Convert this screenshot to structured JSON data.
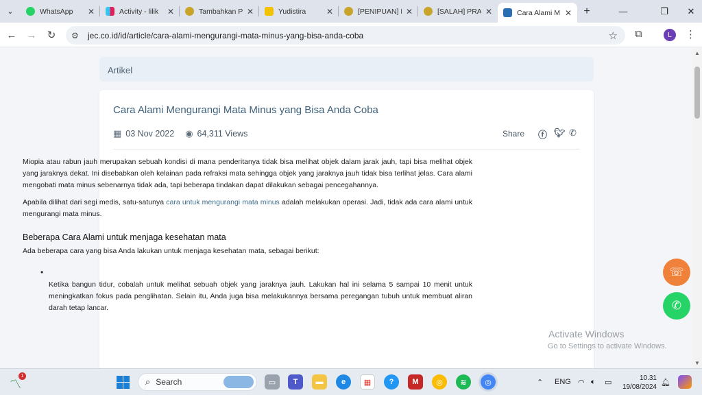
{
  "browser": {
    "tabs": [
      {
        "label": "WhatsApp",
        "icon": "whatsapp-icon",
        "color": "#25d366"
      },
      {
        "label": "Activity - lilik",
        "icon": "slack-icon",
        "color": "#e01e5a"
      },
      {
        "label": "Tambahkan P",
        "icon": "site-logo-icon",
        "color": "#c8a42a"
      },
      {
        "label": "Yudistira",
        "icon": "yudistira-icon",
        "color": "#222222"
      },
      {
        "label": "[PENIPUAN] P",
        "icon": "site-logo-icon",
        "color": "#c8a42a"
      },
      {
        "label": "[SALAH] PRAI",
        "icon": "site-logo-icon",
        "color": "#c8a42a"
      },
      {
        "label": "Cara Alami M",
        "icon": "jec-icon",
        "color": "#2a6fb3"
      }
    ],
    "url": "jec.co.id/id/article/cara-alami-mengurangi-mata-minus-yang-bisa-anda-coba",
    "profile_initial": "L"
  },
  "page": {
    "section_label": "Artikel",
    "title": "Cara Alami Mengurangi Mata Minus yang Bisa Anda Coba",
    "date": "03 Nov 2022",
    "views": "64,311 Views",
    "share_label": "Share",
    "para1": "Miopia atau rabun jauh merupakan sebuah kondisi di mana penderitanya tidak bisa melihat objek dalam jarak jauh, tapi bisa melihat objek yang jaraknya dekat. Ini disebabkan oleh kelainan pada refraksi mata sehingga objek yang jaraknya jauh tidak bisa terlihat jelas. Cara alami mengobati mata minus sebenarnya tidak ada, tapi beberapa tindakan dapat dilakukan sebagai pencegahannya.",
    "para2_before": "Apabila dilihat dari segi medis, satu-satunya ",
    "para2_link": "cara untuk mengurangi mata minus",
    "para2_after": " adalah melakukan operasi. Jadi, tidak ada cara alami untuk mengurangi mata minus.",
    "heading": "Beberapa Cara Alami untuk menjaga kesehatan mata",
    "intro": "Ada beberapa cara yang bisa Anda lakukan untuk menjaga kesehatan mata, sebagai berikut:",
    "bullet1": "Ketika bangun tidur, cobalah untuk melihat sebuah objek yang jaraknya jauh. Lakukan hal ini selama 5 sampai 10 menit untuk meningkatkan fokus pada penglihatan. Selain itu, Anda juga bisa melakukannya bersama peregangan tubuh untuk membuat aliran darah tetap lancar."
  },
  "watermark": {
    "line1": "Activate Windows",
    "line2": "Go to Settings to activate Windows."
  },
  "taskbar": {
    "weather_badge": "1",
    "search_label": "Search",
    "lang": "ENG",
    "time": "10.31",
    "date": "19/08/2024"
  }
}
